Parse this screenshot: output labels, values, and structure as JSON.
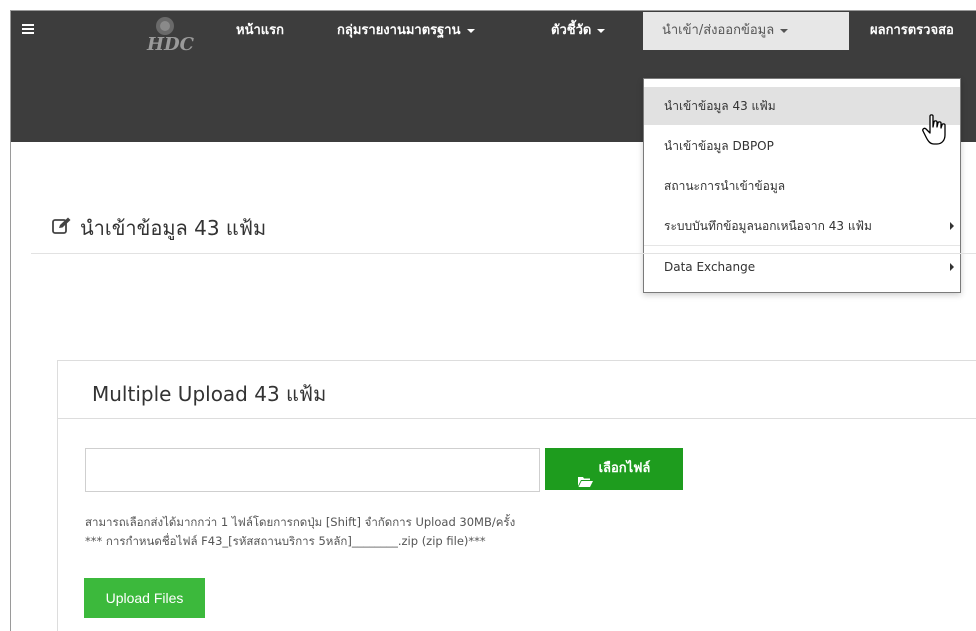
{
  "navbar": {
    "menu_items": [
      {
        "label": "หน้าแรก"
      },
      {
        "label": "กลุ่มรายงานมาตรฐาน"
      },
      {
        "label": "ตัวชี้วัด"
      },
      {
        "label": "นำเข้า/ส่งออกข้อมูล"
      },
      {
        "label": "ผลการตรวจสอ"
      }
    ],
    "logo_text": "HDC"
  },
  "dropdown": {
    "items": [
      {
        "label": "นำเข้าข้อมูล 43 แฟ้ม"
      },
      {
        "label": "นำเข้าข้อมูล DBPOP"
      },
      {
        "label": "สถานะการนำเข้าข้อมูล"
      },
      {
        "label": "ระบบบันทึกข้อมูลนอกเหนือจาก 43 แฟ้ม"
      },
      {
        "label": "Data Exchange"
      }
    ]
  },
  "page": {
    "title": "นำเข้าข้อมูล 43 แฟ้ม"
  },
  "panel": {
    "title": "Multiple Upload 43 แฟ้ม",
    "file_input_value": "",
    "choose_button": "เลือกไฟล์",
    "help_line_1": "สามารถเลือกส่งได้มากกว่า 1 ไฟล์โดยการกดปุ่ม [Shift] จำกัดการ Upload 30MB/ครั้ง",
    "help_line_2": "*** การกำหนดชื่อไฟล์ F43_[รหัสสถานบริการ 5หลัก]________.zip (zip file)***",
    "upload_button": "Upload Files"
  },
  "colors": {
    "navbar_bg": "#3d3d3d",
    "active_nav_bg": "#e7e7e7",
    "choose_button_bg": "#1e9c1e",
    "upload_button_bg": "#3cb93c"
  }
}
